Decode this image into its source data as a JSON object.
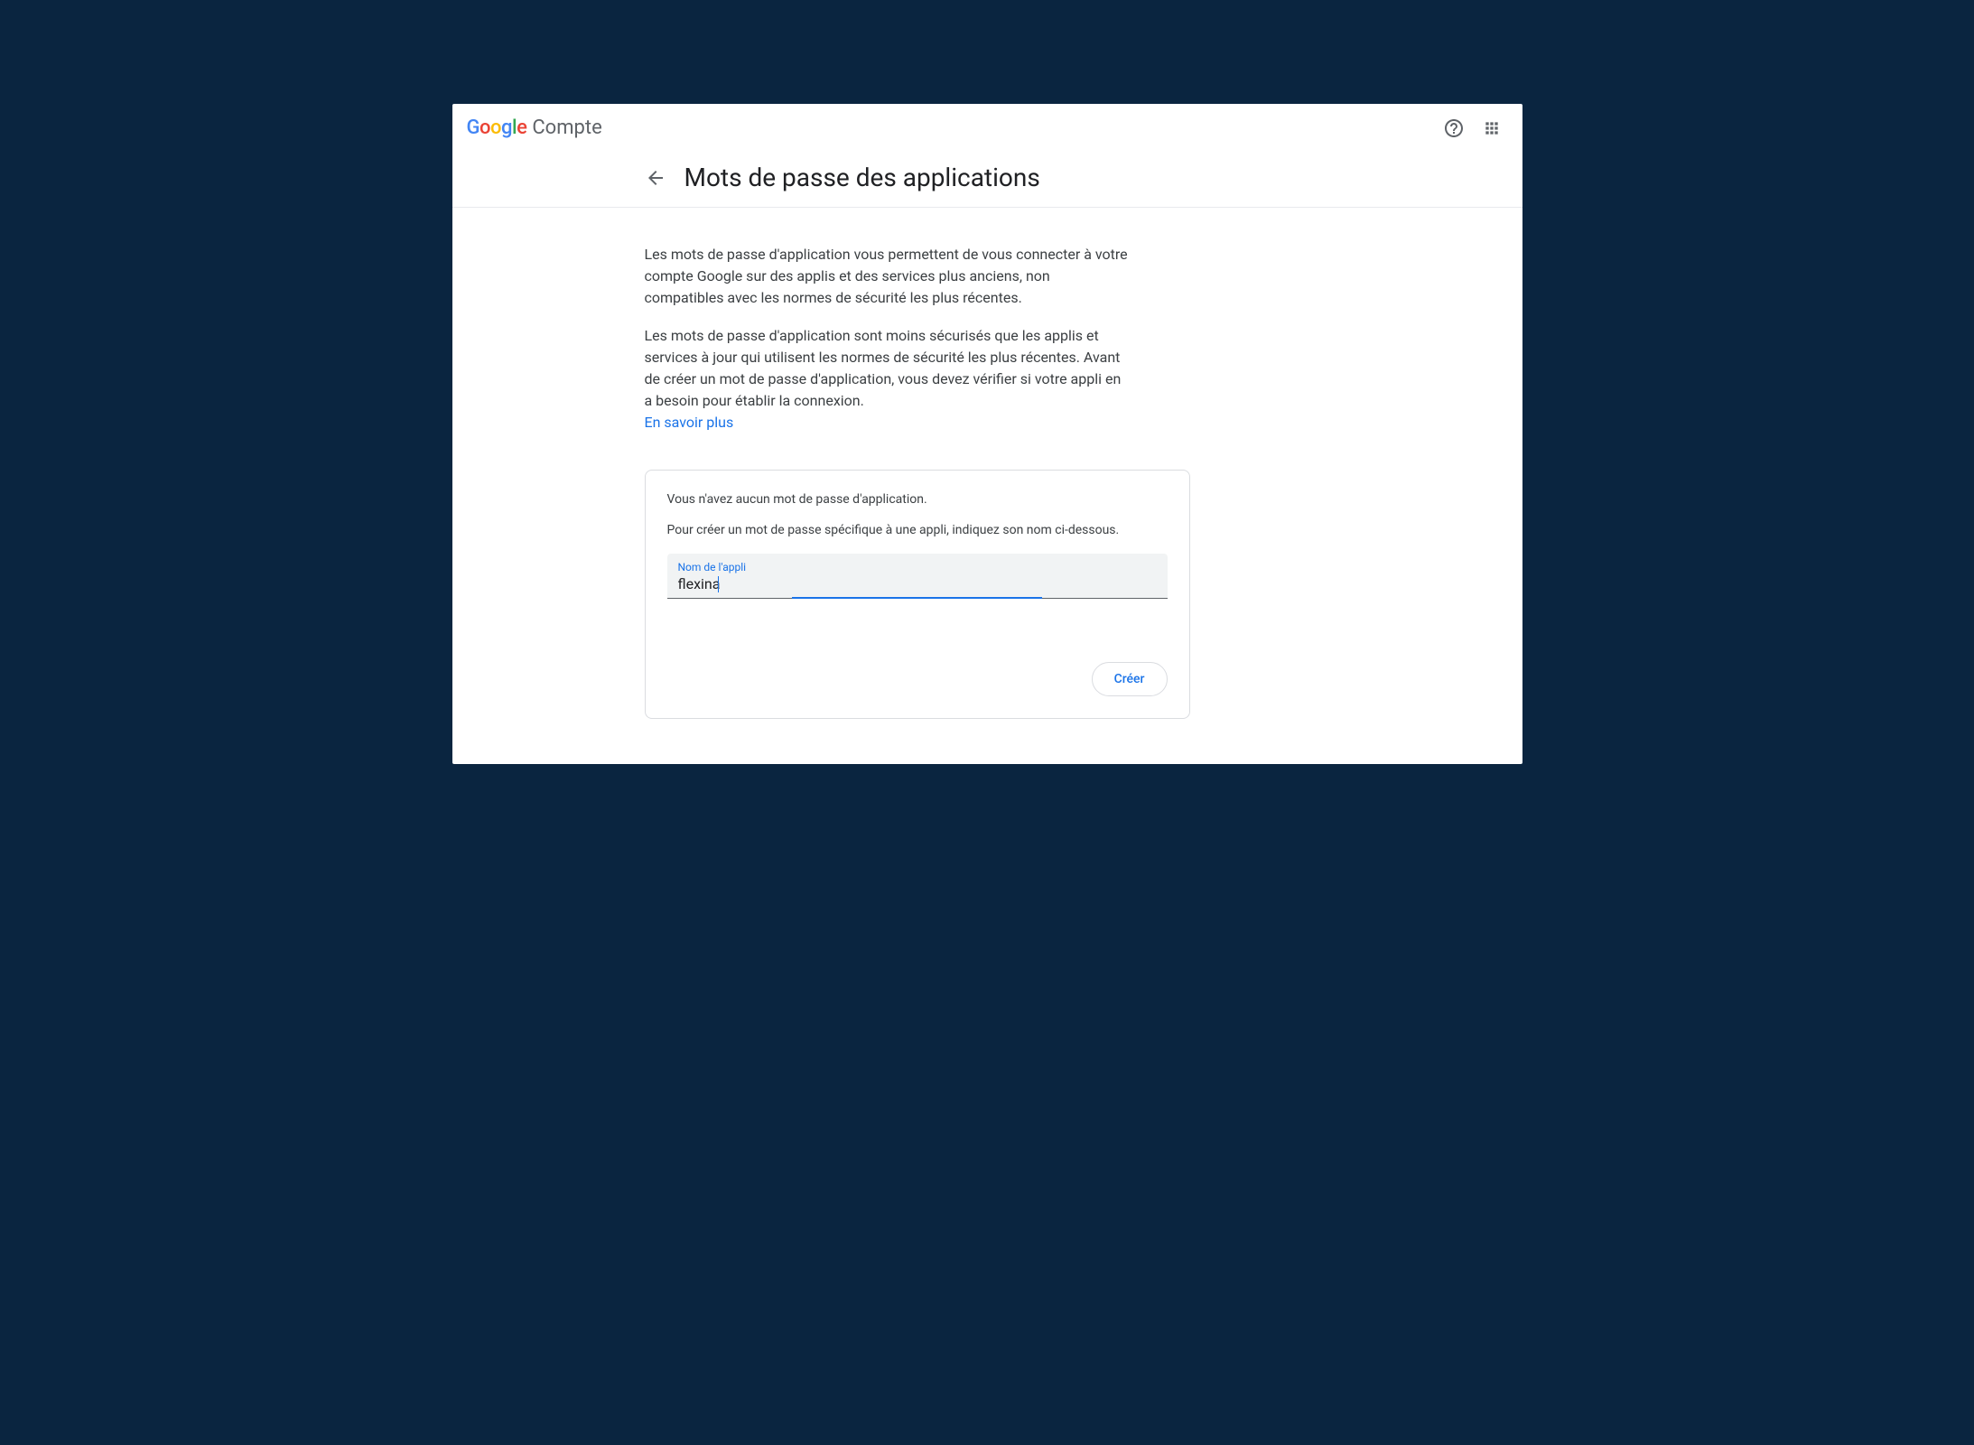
{
  "header": {
    "logo": {
      "letters": [
        "G",
        "o",
        "o",
        "g",
        "l",
        "e"
      ]
    },
    "product": "Compte"
  },
  "page": {
    "title": "Mots de passe des applications",
    "description1": "Les mots de passe d'application vous permettent de vous connecter à votre compte Google sur des applis et des services plus anciens, non compatibles avec les normes de sécurité les plus récentes.",
    "description2": "Les mots de passe d'application sont moins sécurisés que les applis et services à jour qui utilisent les normes de sécurité les plus récentes. Avant de créer un mot de passe d'application, vous devez vérifier si votre appli en a besoin pour établir la connexion.",
    "learn_more": "En savoir plus"
  },
  "card": {
    "empty_state": "Vous n'avez aucun mot de passe d'application.",
    "instruction": "Pour créer un mot de passe spécifique à une appli, indiquez son nom ci-dessous.",
    "input_label": "Nom de l'appli",
    "input_value": "flexina",
    "create_button": "Créer"
  }
}
